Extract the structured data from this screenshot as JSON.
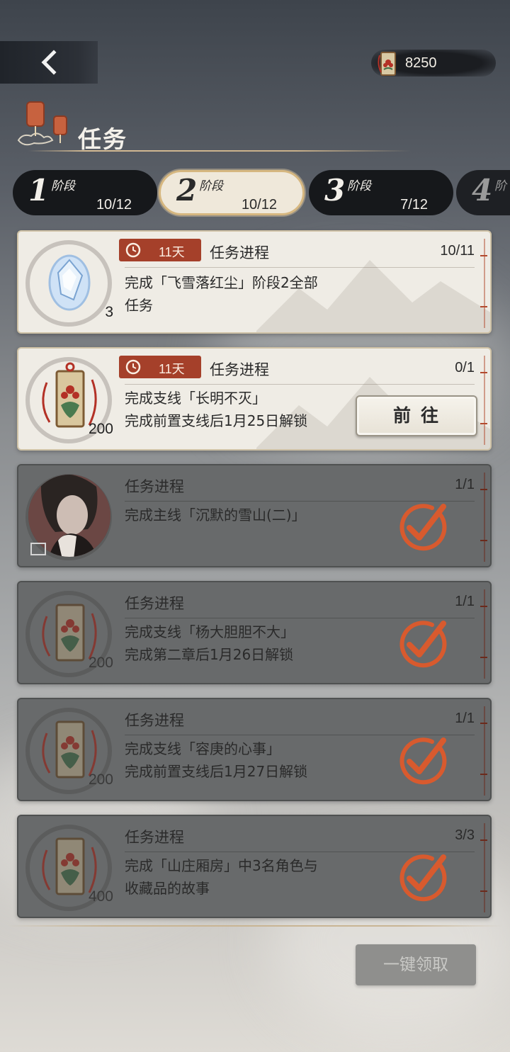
{
  "topbar": {
    "back_label": "back",
    "currency_value": "8250"
  },
  "header": {
    "title": "任务"
  },
  "stages": [
    {
      "number": "1",
      "label": "阶段",
      "count": "10/12",
      "active": false
    },
    {
      "number": "2",
      "label": "阶段",
      "count": "10/12",
      "active": true
    },
    {
      "number": "3",
      "label": "阶段",
      "count": "7/12",
      "active": false
    },
    {
      "number": "4",
      "label": "阶",
      "count": "",
      "active": false
    }
  ],
  "tasks": [
    {
      "timer": "11天",
      "label": "任务进程",
      "progress": "10/11",
      "line1": "完成「飞雪落红尘」阶段2全部",
      "line2": "任务",
      "reward_qty": "3",
      "reward": "crystal-icon",
      "status": "in-progress"
    },
    {
      "timer": "11天",
      "label": "任务进程",
      "progress": "0/1",
      "line1": "完成支线「长明不灭」",
      "line2": "完成前置支线后1月25日解锁",
      "reward_qty": "200",
      "reward": "charm-icon",
      "status": "locked",
      "button": "前往"
    },
    {
      "label": "任务进程",
      "progress": "1/1",
      "line1": "完成主线「沉默的雪山(二)」",
      "line2": "",
      "reward_qty": "",
      "reward": "portrait-icon",
      "status": "done"
    },
    {
      "label": "任务进程",
      "progress": "1/1",
      "line1": "完成支线「杨大胆胆不大」",
      "line2": "完成第二章后1月26日解锁",
      "reward_qty": "200",
      "reward": "charm-icon",
      "status": "done"
    },
    {
      "label": "任务进程",
      "progress": "1/1",
      "line1": "完成支线「容庚的心事」",
      "line2": "完成前置支线后1月27日解锁",
      "reward_qty": "200",
      "reward": "charm-icon",
      "status": "done"
    },
    {
      "label": "任务进程",
      "progress": "3/3",
      "line1": "完成「山庄厢房」中3名角色与",
      "line2": "收藏品的故事",
      "reward_qty": "400",
      "reward": "charm-icon",
      "status": "done"
    }
  ],
  "footer": {
    "claim_all_label": "一键领取"
  },
  "colors": {
    "accent": "#a5402a",
    "check": "#d85a2e",
    "card": "#efece5",
    "card_done": "#686a6b"
  }
}
